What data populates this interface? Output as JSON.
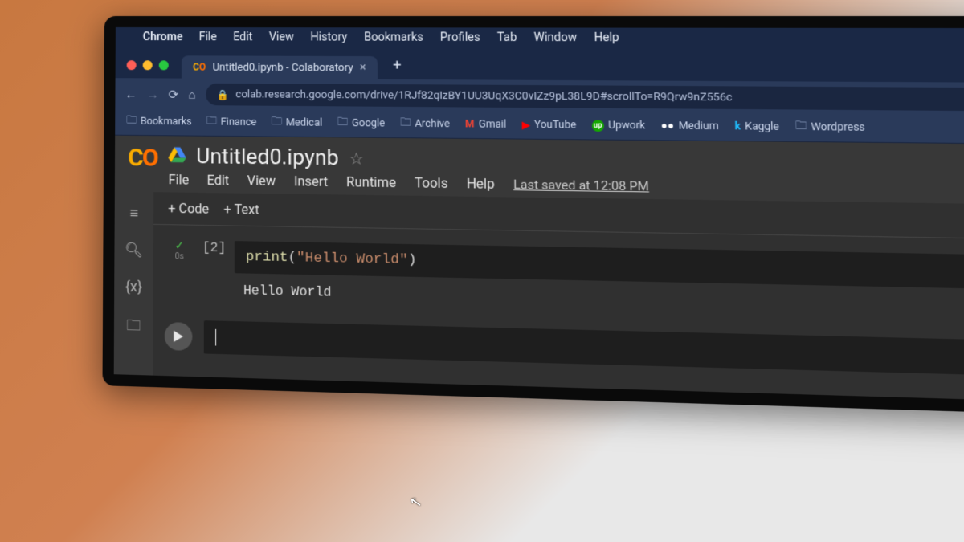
{
  "mac_menu": {
    "app": "Chrome",
    "items": [
      "File",
      "Edit",
      "View",
      "History",
      "Bookmarks",
      "Profiles",
      "Tab",
      "Window",
      "Help"
    ]
  },
  "tab": {
    "title": "Untitled0.ipynb - Colaboratory"
  },
  "url": "colab.research.google.com/drive/1RJf82qIzBY1UU3UqX3C0vIZz9pL38L9D#scrollTo=R9Qrw9nZ556c",
  "bookmarks": [
    {
      "label": "Bookmarks",
      "icon": "folder"
    },
    {
      "label": "Finance",
      "icon": "folder"
    },
    {
      "label": "Medical",
      "icon": "folder"
    },
    {
      "label": "Google",
      "icon": "folder"
    },
    {
      "label": "Archive",
      "icon": "folder"
    },
    {
      "label": "Gmail",
      "icon": "gmail"
    },
    {
      "label": "YouTube",
      "icon": "youtube"
    },
    {
      "label": "Upwork",
      "icon": "upwork"
    },
    {
      "label": "Medium",
      "icon": "medium"
    },
    {
      "label": "Kaggle",
      "icon": "kaggle"
    },
    {
      "label": "Wordpress",
      "icon": "folder"
    }
  ],
  "notebook": {
    "title": "Untitled0.ipynb",
    "menus": [
      "File",
      "Edit",
      "View",
      "Insert",
      "Runtime",
      "Tools",
      "Help"
    ],
    "saved": "Last saved at 12:08 PM"
  },
  "toolbar": {
    "code": "+ Code",
    "text": "+ Text"
  },
  "cell1": {
    "exec": "[2]",
    "time": "0s",
    "fn": "print",
    "paren_open": "(",
    "str": "\"Hello World\"",
    "paren_close": ")",
    "output": "Hello World"
  }
}
